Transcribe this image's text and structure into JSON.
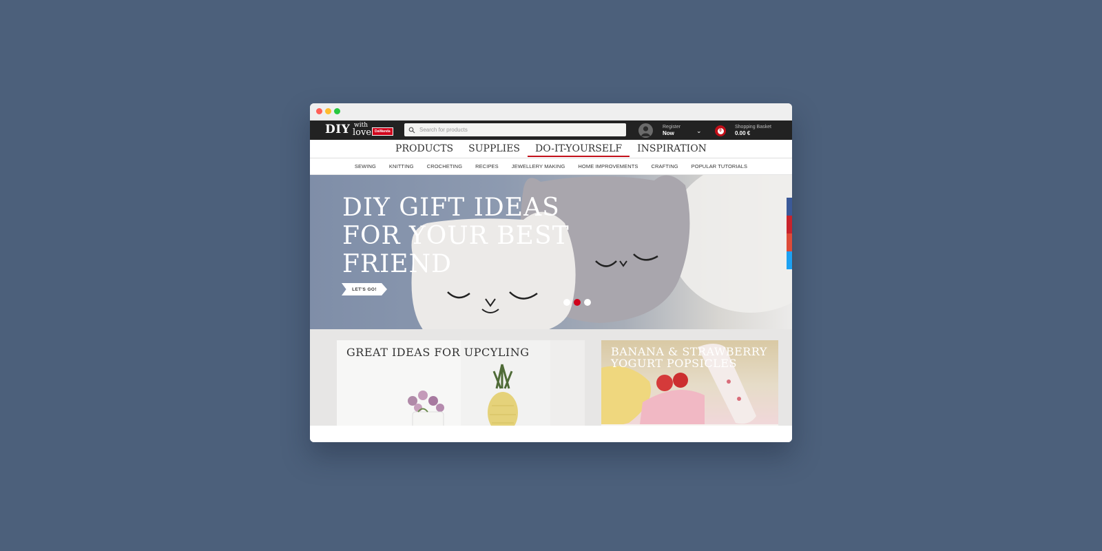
{
  "window": {
    "controls": [
      "close",
      "minimize",
      "maximize"
    ]
  },
  "header": {
    "logo": {
      "main": "DIY",
      "with": "with",
      "love": "love",
      "tag": "DaWanda"
    },
    "search": {
      "placeholder": "Search for products",
      "icon": "search-icon"
    },
    "account": {
      "line1": "Register",
      "line2": "Now",
      "icon": "user-avatar-icon"
    },
    "basket": {
      "count": "0",
      "label": "Shopping Basket",
      "amount": "0.00 €",
      "icon": "basket-icon"
    }
  },
  "main_nav": {
    "items": [
      {
        "label": "PRODUCTS",
        "active": false
      },
      {
        "label": "SUPPLIES",
        "active": false
      },
      {
        "label": "DO-IT-YOURSELF",
        "active": true
      },
      {
        "label": "INSPIRATION",
        "active": false
      }
    ],
    "active_color": "#c20f19"
  },
  "sub_nav": {
    "items": [
      "SEWING",
      "KNITTING",
      "CROCHETING",
      "RECIPES",
      "JEWELLERY MAKING",
      "HOME IMPROVEMENTS",
      "CRAFTING",
      "POPULAR TUTORIALS"
    ]
  },
  "hero": {
    "title_lines": [
      "DIY GIFT IDEAS",
      "FOR YOUR BEST",
      "FRIEND"
    ],
    "cta": "LET'S GO!",
    "slides": 3,
    "active_slide": 2
  },
  "social_bar": {
    "colors": [
      "#3b5998",
      "#c8232c",
      "#dd4b39",
      "#1da1f2"
    ]
  },
  "cards": [
    {
      "title": "GREAT IDEAS FOR UPCYLING"
    },
    {
      "title": "BANANA & STRAWBERRY YOGURT POPSICLES"
    }
  ],
  "colors": {
    "background": "#4c607b",
    "topbar": "#222222",
    "accent": "#c20f19"
  }
}
